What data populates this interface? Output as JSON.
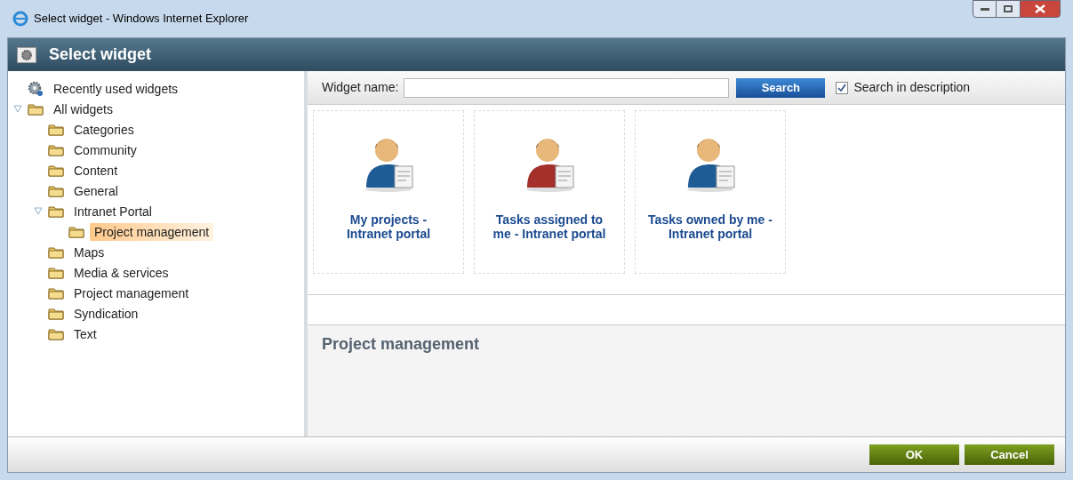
{
  "window": {
    "title": "Select widget - Windows Internet Explorer"
  },
  "dialog": {
    "title": "Select widget"
  },
  "tree": [
    {
      "label": "Recently used widgets",
      "kind": "recent",
      "selected": false
    },
    {
      "label": "All widgets",
      "kind": "folder",
      "selected": false,
      "expanded": true,
      "children": [
        {
          "label": "Categories",
          "kind": "folder",
          "selected": false
        },
        {
          "label": "Community",
          "kind": "folder",
          "selected": false
        },
        {
          "label": "Content",
          "kind": "folder",
          "selected": false
        },
        {
          "label": "General",
          "kind": "folder",
          "selected": false
        },
        {
          "label": "Intranet Portal",
          "kind": "folder",
          "selected": false,
          "expanded": true,
          "children": [
            {
              "label": "Project management",
              "kind": "folder",
              "selected": true
            }
          ]
        },
        {
          "label": "Maps",
          "kind": "folder",
          "selected": false
        },
        {
          "label": "Media & services",
          "kind": "folder",
          "selected": false
        },
        {
          "label": "Project management",
          "kind": "folder",
          "selected": false
        },
        {
          "label": "Syndication",
          "kind": "folder",
          "selected": false
        },
        {
          "label": "Text",
          "kind": "folder",
          "selected": false
        }
      ]
    }
  ],
  "search": {
    "label": "Widget name:",
    "button": "Search",
    "in_description": {
      "label": "Search in description",
      "checked": true
    }
  },
  "widgets": [
    {
      "title": "My projects - Intranet portal",
      "color": "#1f5b94"
    },
    {
      "title": "Tasks assigned to me - Intranet portal",
      "color": "#a3302b"
    },
    {
      "title": "Tasks owned by me - Intranet portal",
      "color": "#1f5b94"
    }
  ],
  "description": {
    "title": "Project management"
  },
  "buttons": [
    "OK",
    "Cancel"
  ]
}
